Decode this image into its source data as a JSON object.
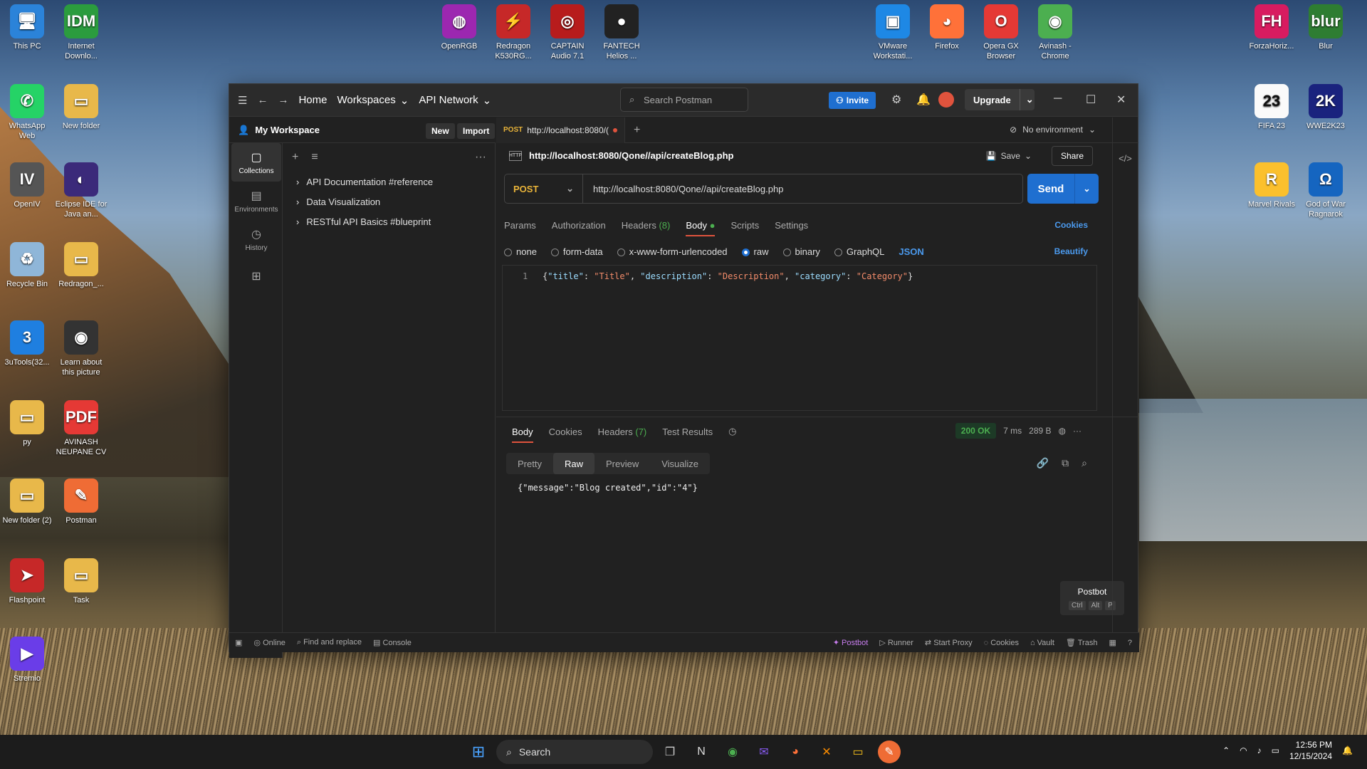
{
  "desktop": {
    "left_icons": [
      {
        "label": "This PC",
        "glyph": "🖥",
        "color": "#2b83d9"
      },
      {
        "label": "Internet Downlo...",
        "glyph": "IDM",
        "color": "#2b9c3e"
      },
      {
        "label": "WhatsApp Web",
        "glyph": "✆",
        "color": "#25d366"
      },
      {
        "label": "New folder",
        "glyph": "▭",
        "color": "#e8b84a"
      },
      {
        "label": "OpenIV",
        "glyph": "IV",
        "color": "#555"
      },
      {
        "label": "Eclipse IDE for Java an...",
        "glyph": "◐",
        "color": "#3b2a7a"
      },
      {
        "label": "Recycle Bin",
        "glyph": "♻",
        "color": "#8fb6d8"
      },
      {
        "label": "Redragon_...",
        "glyph": "▭",
        "color": "#e8b84a"
      },
      {
        "label": "3uTools(32...",
        "glyph": "3",
        "color": "#1f7fe0"
      },
      {
        "label": "Learn about this picture",
        "glyph": "◉",
        "color": "#333"
      },
      {
        "label": "py",
        "glyph": "▭",
        "color": "#e8b84a"
      },
      {
        "label": "AVINASH NEUPANE CV",
        "glyph": "PDF",
        "color": "#e53935"
      },
      {
        "label": "New folder (2)",
        "glyph": "▭",
        "color": "#e8b84a"
      },
      {
        "label": "Postman",
        "glyph": "✎",
        "color": "#ef6c35"
      },
      {
        "label": "Flashpoint",
        "glyph": "➤",
        "color": "#c62828"
      },
      {
        "label": "Task",
        "glyph": "▭",
        "color": "#e8b84a"
      },
      {
        "label": "Stremio",
        "glyph": "▶",
        "color": "#6a3de8"
      }
    ],
    "top_icons": [
      {
        "label": "OpenRGB",
        "glyph": "◍",
        "color": "#9c27b0"
      },
      {
        "label": "Redragon K530RG...",
        "glyph": "⚡",
        "color": "#c62828"
      },
      {
        "label": "CAPTAIN Audio 7.1",
        "glyph": "◎",
        "color": "#b71c1c"
      },
      {
        "label": "FANTECH Helios ...",
        "glyph": "●",
        "color": "#222"
      },
      {
        "label": "VMware Workstati...",
        "glyph": "▣",
        "color": "#1e88e5"
      },
      {
        "label": "Firefox",
        "glyph": "◕",
        "color": "#ff7139"
      },
      {
        "label": "Opera GX Browser",
        "glyph": "O",
        "color": "#e53935"
      },
      {
        "label": "Avinash - Chrome",
        "glyph": "◉",
        "color": "#4caf50"
      },
      {
        "label": "ForzaHoriz...",
        "glyph": "FH",
        "color": "#d81b60"
      },
      {
        "label": "Blur",
        "glyph": "blur",
        "color": "#2e7d32"
      },
      {
        "label": "FIFA 23",
        "glyph": "23",
        "color": "#fafafa"
      },
      {
        "label": "WWE2K23",
        "glyph": "2K",
        "color": "#1a237e"
      },
      {
        "label": "Marvel Rivals",
        "glyph": "R",
        "color": "#fbc02d"
      },
      {
        "label": "God of War Ragnarok",
        "glyph": "Ω",
        "color": "#1565c0"
      }
    ]
  },
  "window": {
    "nav": {
      "home": "Home",
      "workspaces": "Workspaces",
      "api_network": "API Network"
    },
    "search_placeholder": "Search Postman",
    "invite": "Invite",
    "upgrade": "Upgrade",
    "workspace": {
      "title": "My Workspace",
      "new": "New",
      "import": "Import"
    },
    "sidebar": [
      {
        "label": "Collections",
        "icon": "▢"
      },
      {
        "label": "Environments",
        "icon": "▤"
      },
      {
        "label": "History",
        "icon": "◷"
      },
      {
        "label": "",
        "icon": "⊞"
      }
    ],
    "collections": [
      "API Documentation #reference",
      "Data Visualization",
      "RESTful API Basics #blueprint"
    ],
    "tab": {
      "method": "POST",
      "label": "http://localhost:8080/("
    },
    "environment": "No environment",
    "request": {
      "title": "http://localhost:8080/Qone//api/createBlog.php",
      "save": "Save",
      "share": "Share",
      "method": "POST",
      "url": "http://localhost:8080/Qone//api/createBlog.php",
      "send": "Send",
      "tabs": {
        "params": "Params",
        "authorization": "Authorization",
        "headers": "Headers",
        "headers_count": "(8)",
        "body": "Body",
        "scripts": "Scripts",
        "settings": "Settings"
      },
      "cookies": "Cookies",
      "body_options": [
        "none",
        "form-data",
        "x-www-form-urlencoded",
        "raw",
        "binary",
        "GraphQL"
      ],
      "selected_option": "raw",
      "format": "JSON",
      "beautify": "Beautify",
      "line_number": "1",
      "body_code": {
        "open": "{",
        "k1": "\"title\"",
        "v1": "\"Title\"",
        "k2": "\"description\"",
        "v2": "\"Description\"",
        "k3": "\"category\"",
        "v3": "\"Category\"",
        "close": "}"
      }
    },
    "response": {
      "tabs": {
        "body": "Body",
        "cookies": "Cookies",
        "headers": "Headers",
        "headers_count": "(7)",
        "test_results": "Test Results"
      },
      "status": "200 OK",
      "time": "7 ms",
      "size": "289 B",
      "formats": [
        "Pretty",
        "Raw",
        "Preview",
        "Visualize"
      ],
      "selected_format": "Raw",
      "body": "{\"message\":\"Blog created\",\"id\":\"4\"}"
    },
    "postbot_tip": {
      "title": "Postbot",
      "keys": [
        "Ctrl",
        "Alt",
        "P"
      ]
    },
    "statusbar": {
      "left": [
        "Online",
        "Find and replace",
        "Console"
      ],
      "right": [
        "Postbot",
        "Runner",
        "Start Proxy",
        "Cookies",
        "Vault",
        "Trash"
      ]
    }
  },
  "taskbar": {
    "search": "Search",
    "time": "12:56 PM",
    "date": "12/15/2024"
  },
  "colors": {
    "accent": "#1f6fd0",
    "post": "#e8b339",
    "ok": "#4caf50",
    "tab_indicator": "#e0533d"
  }
}
